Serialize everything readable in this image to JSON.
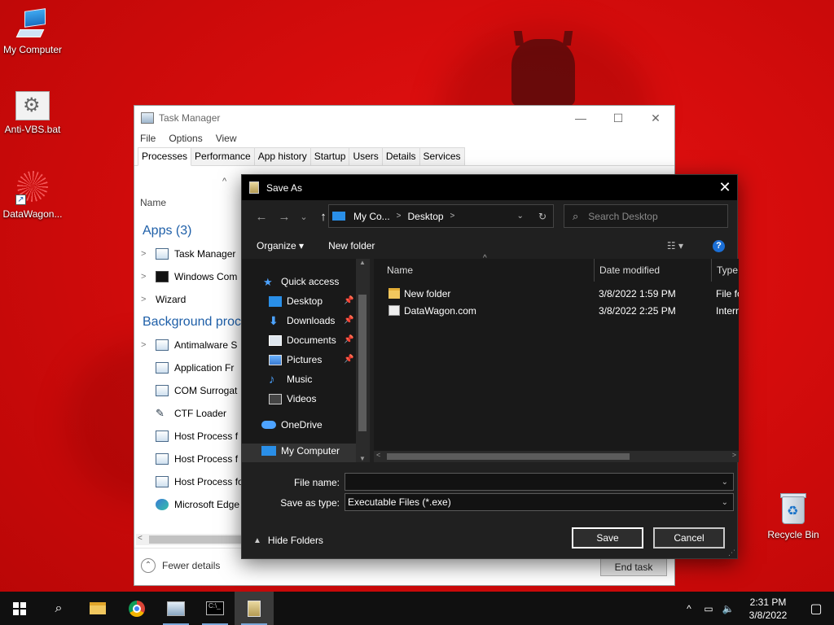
{
  "desktop": {
    "icons": [
      {
        "label": "My Computer"
      },
      {
        "label": "Anti-VBS.bat"
      },
      {
        "label": "DataWagon..."
      },
      {
        "label": "Recycle Bin"
      }
    ]
  },
  "task_manager": {
    "title": "Task Manager",
    "controls": {
      "minimize": "—",
      "maximize": "☐",
      "close": "✕"
    },
    "menu": [
      "File",
      "Options",
      "View"
    ],
    "tabs": [
      "Processes",
      "Performance",
      "App history",
      "Startup",
      "Users",
      "Details",
      "Services"
    ],
    "sort_caret": "^",
    "column_name": "Name",
    "apps_group": "Apps (3)",
    "apps": [
      "Task Manager",
      "Windows Com",
      "Wizard"
    ],
    "background_group": "Background proc",
    "background": [
      "Antimalware S",
      "Application Fr",
      "COM Surrogat",
      "CTF Loader",
      "Host Process f",
      "Host Process f",
      "Host Process fo",
      "Microsoft Edge"
    ],
    "fewer_details": "Fewer details",
    "end_task": "End task"
  },
  "save_as": {
    "title": "Save As",
    "close": "✕",
    "nav": {
      "back": "←",
      "forward": "→",
      "recent": "⌄",
      "up": "↑"
    },
    "address": {
      "segments": [
        "My Co...",
        "Desktop"
      ],
      "separator": ">",
      "dropdown": "⌄",
      "refresh": "↻"
    },
    "search": {
      "placeholder": "Search Desktop",
      "icon": "⌕"
    },
    "organize": "Organize ▾",
    "new_folder": "New folder",
    "views": "☷ ▾",
    "help": "?",
    "navigation": [
      {
        "label": "Quick access",
        "icon": "star-icon"
      },
      {
        "label": "Desktop",
        "icon": "desktop-icon",
        "pinned": true
      },
      {
        "label": "Downloads",
        "icon": "download-icon",
        "pinned": true
      },
      {
        "label": "Documents",
        "icon": "documents-icon",
        "pinned": true
      },
      {
        "label": "Pictures",
        "icon": "pictures-icon",
        "pinned": true
      },
      {
        "label": "Music",
        "icon": "music-icon"
      },
      {
        "label": "Videos",
        "icon": "videos-icon"
      },
      {
        "label": "OneDrive",
        "icon": "cloud-icon"
      },
      {
        "label": "My Computer",
        "icon": "computer-icon",
        "selected": true
      }
    ],
    "columns": {
      "name": "Name",
      "date": "Date modified",
      "type": "Type"
    },
    "files": [
      {
        "name": "New folder",
        "date": "3/8/2022 1:59 PM",
        "type": "File fo",
        "icon": "folder-icon"
      },
      {
        "name": "DataWagon.com",
        "date": "3/8/2022 2:25 PM",
        "type": "Intern",
        "icon": "exe-icon"
      }
    ],
    "file_name_label": "File name:",
    "file_name_value": "",
    "save_type_label": "Save as type:",
    "save_type_value": "Executable Files (*.exe)",
    "hide_folders": "Hide Folders",
    "save": "Save",
    "cancel": "Cancel"
  },
  "taskbar": {
    "time": "2:31 PM",
    "date": "3/8/2022",
    "tray": {
      "chevron": "^",
      "network": "▭",
      "volume": "🔈",
      "notification": "▢"
    }
  }
}
